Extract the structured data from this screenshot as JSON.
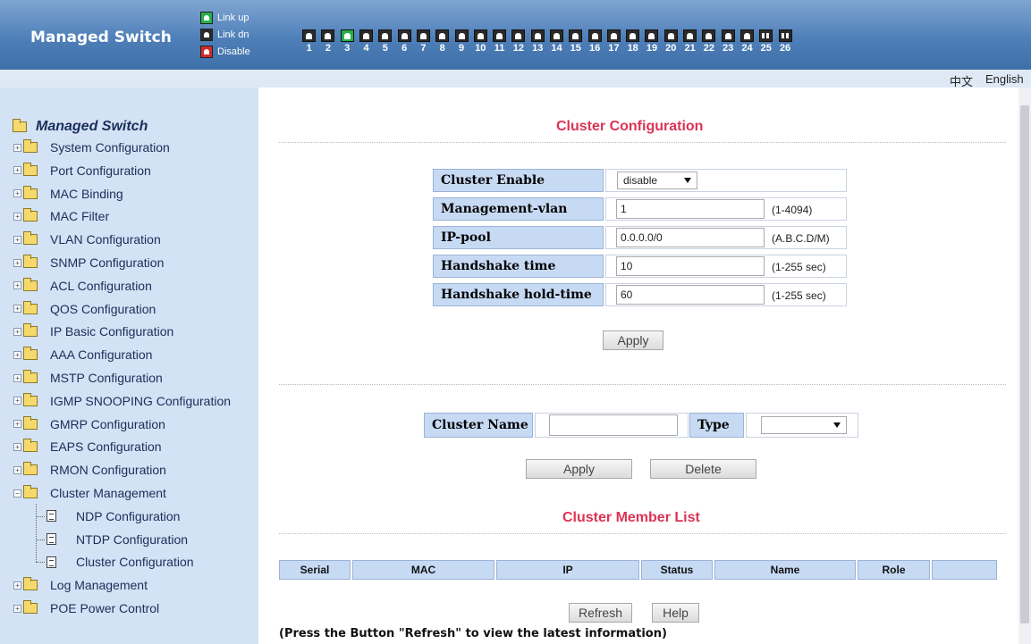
{
  "header": {
    "brand": "Managed Switch",
    "legend": [
      {
        "label": "Link up",
        "color": "#27b04a",
        "icon": "port-linkup-icon"
      },
      {
        "label": "Link dn",
        "color": "#2a2a2a",
        "icon": "port-linkdown-icon"
      },
      {
        "label": "Disable",
        "color": "#d12a2a",
        "icon": "port-disabled-icon"
      }
    ],
    "ports": [
      {
        "num": "1",
        "state": "down"
      },
      {
        "num": "2",
        "state": "down"
      },
      {
        "num": "3",
        "state": "up"
      },
      {
        "num": "4",
        "state": "down"
      },
      {
        "num": "5",
        "state": "down"
      },
      {
        "num": "6",
        "state": "down"
      },
      {
        "num": "7",
        "state": "down"
      },
      {
        "num": "8",
        "state": "down"
      },
      {
        "num": "9",
        "state": "down"
      },
      {
        "num": "10",
        "state": "down"
      },
      {
        "num": "11",
        "state": "down"
      },
      {
        "num": "12",
        "state": "down"
      },
      {
        "num": "13",
        "state": "down"
      },
      {
        "num": "14",
        "state": "down"
      },
      {
        "num": "15",
        "state": "down"
      },
      {
        "num": "16",
        "state": "down"
      },
      {
        "num": "17",
        "state": "down"
      },
      {
        "num": "18",
        "state": "down"
      },
      {
        "num": "19",
        "state": "down"
      },
      {
        "num": "20",
        "state": "down"
      },
      {
        "num": "21",
        "state": "down"
      },
      {
        "num": "22",
        "state": "down"
      },
      {
        "num": "23",
        "state": "down"
      },
      {
        "num": "24",
        "state": "down"
      },
      {
        "num": "25",
        "state": "fiber"
      },
      {
        "num": "26",
        "state": "fiber"
      }
    ]
  },
  "lang": {
    "zh": "中文",
    "en": "English"
  },
  "sidebar": {
    "root": "Managed Switch",
    "items": [
      "System Configuration",
      "Port Configuration",
      "MAC Binding",
      "MAC Filter",
      "VLAN Configuration",
      "SNMP Configuration",
      "ACL Configuration",
      "QOS Configuration",
      "IP Basic Configuration",
      "AAA Configuration",
      "MSTP Configuration",
      "IGMP SNOOPING Configuration",
      "GMRP Configuration",
      "EAPS Configuration",
      "RMON Configuration",
      "Cluster Management"
    ],
    "cluster_children": [
      "NDP Configuration",
      "NTDP Configuration",
      "Cluster Configuration"
    ],
    "tail_items": [
      "Log Management",
      "POE Power Control"
    ]
  },
  "config": {
    "title": "Cluster Configuration",
    "enable_label": "Cluster Enable",
    "enable_value": "disable",
    "vlan_label": "Management-vlan",
    "vlan_value": "1",
    "vlan_hint": "(1-4094)",
    "pool_label": "IP-pool",
    "pool_value": "0.0.0.0/0",
    "pool_hint": "(A.B.C.D/M)",
    "hs_label": "Handshake time",
    "hs_value": "10",
    "hs_hint": "(1-255 sec)",
    "hold_label": "Handshake hold-time",
    "hold_value": "60",
    "hold_hint": "(1-255 sec)",
    "apply": "Apply"
  },
  "name_form": {
    "name_label": "Cluster Name",
    "name_value": "",
    "type_label": "Type",
    "type_value": "",
    "apply": "Apply",
    "delete": "Delete"
  },
  "members": {
    "title": "Cluster Member List",
    "columns": [
      "Serial",
      "MAC",
      "IP",
      "Status",
      "Name",
      "Role",
      ""
    ],
    "refresh": "Refresh",
    "help": "Help",
    "note": "(Press the Button \"Refresh\" to view the latest information)"
  }
}
